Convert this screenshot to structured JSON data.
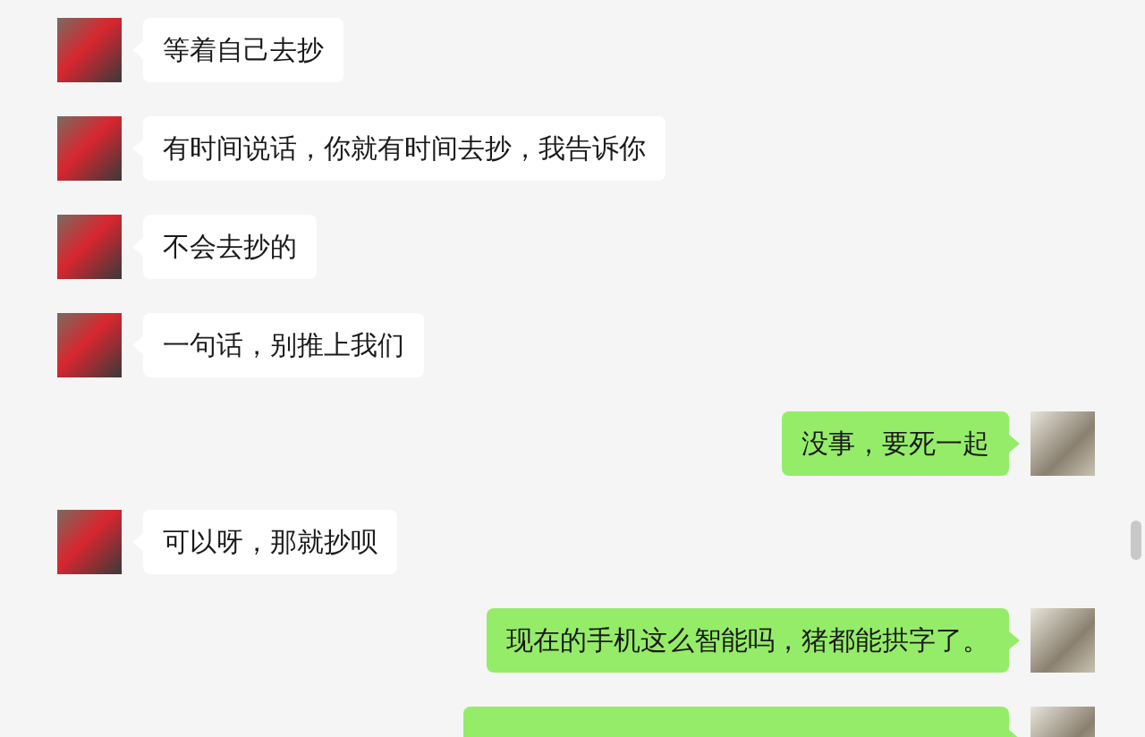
{
  "messages": [
    {
      "kind": "incoming",
      "text": "等着自己去抄"
    },
    {
      "kind": "incoming",
      "text": "有时间说话，你就有时间去抄，我告诉你"
    },
    {
      "kind": "incoming",
      "text": "不会去抄的"
    },
    {
      "kind": "incoming",
      "text": "一句话，别推上我们"
    },
    {
      "kind": "outgoing",
      "text": "没事，要死一起"
    },
    {
      "kind": "incoming",
      "text": "可以呀，那就抄呗"
    },
    {
      "kind": "outgoing",
      "text": "现在的手机这么智能吗，猪都能拱字了。"
    },
    {
      "kind": "outgoing"
    }
  ]
}
